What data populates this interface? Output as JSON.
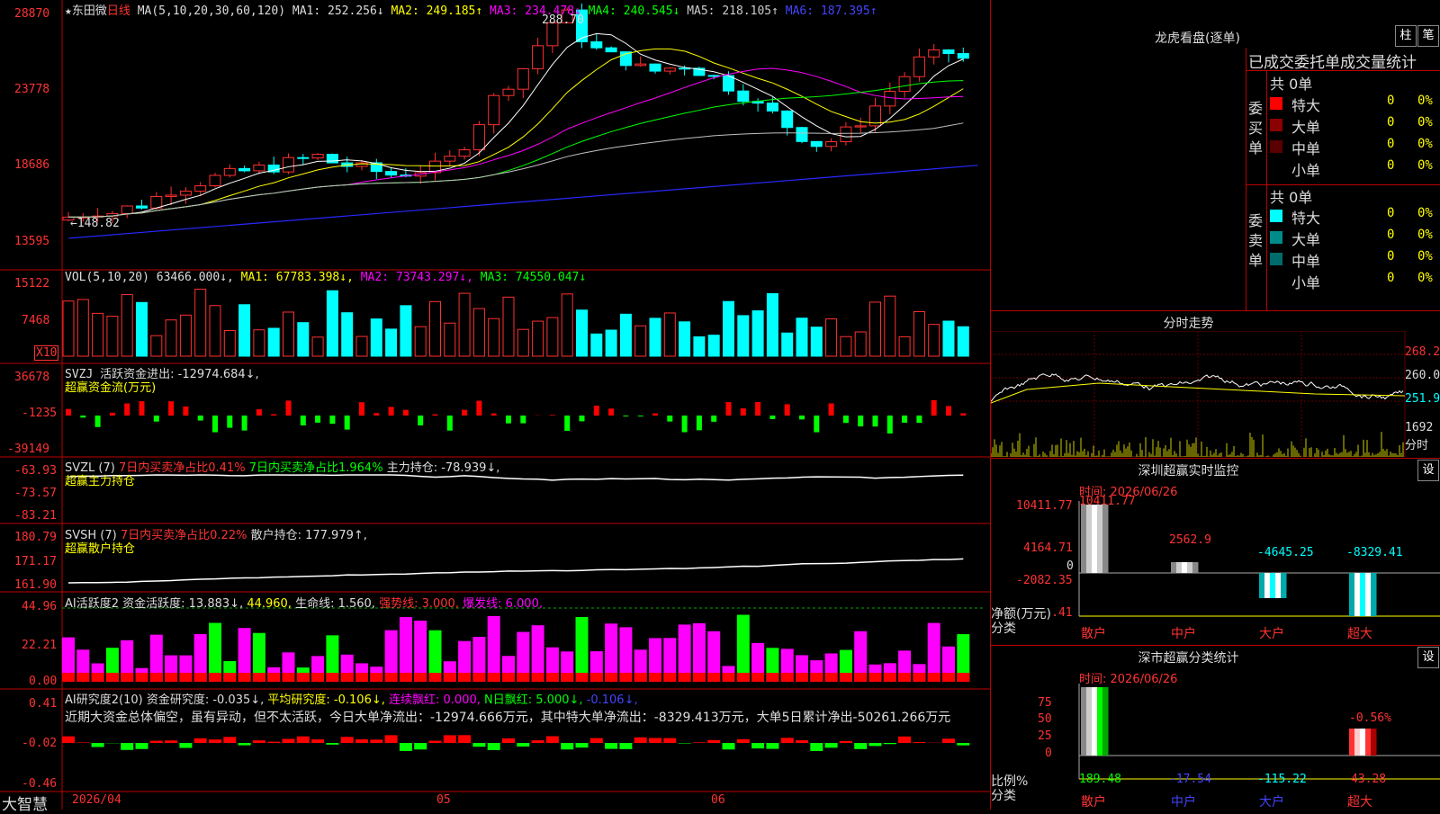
{
  "colors": {
    "up": "#ff3030",
    "down": "#00ffff",
    "ma1": "#ffffff",
    "ma2": "#ffff00",
    "ma3": "#ff00ff",
    "ma4": "#00ff00",
    "ma5": "#c0c0c0",
    "ma6": "#2828ff"
  },
  "price_panel": {
    "header": {
      "star": "★",
      "name": "东田微",
      "period": "日线",
      "ma_label": "MA(5,10,20,30,60,120)",
      "ma1": "MA1: 252.256↓",
      "ma2": "MA2: 249.185↑",
      "ma3": "MA3: 234.478↓",
      "ma4": "MA4: 240.545↓",
      "ma5": "MA5: 218.105↑",
      "ma6": "MA6: 187.395↑"
    },
    "y_ticks": [
      "28870",
      "23778",
      "18686",
      "13595"
    ],
    "high_label": "288.70",
    "low_label": "←148.82"
  },
  "vol_panel": {
    "header": "VOL(5,10,20)",
    "value": "63466.000↓,",
    "ma1": "MA1: 67783.398↓,",
    "ma2": "MA2: 73743.297↓,",
    "ma3": "MA3: 74550.047↓",
    "y_ticks": [
      "15122",
      "7468"
    ],
    "unit": "X10"
  },
  "svzj_panel": {
    "header": "SVZJ",
    "label": "活跃资金进出: -12974.684↓,",
    "sub": "超赢资金流(万元)",
    "y_ticks": [
      "36678",
      "-1235",
      "-39149"
    ]
  },
  "svzl_panel": {
    "header": "SVZL (7)",
    "a": "7日内买卖净占比0.41%",
    "b": "7日内买卖净占比1.964%",
    "c": "主力持仓: -78.939↓,",
    "sub": "超赢主力持仓",
    "y_ticks": [
      "-63.93",
      "-73.57",
      "-83.21"
    ]
  },
  "svsh_panel": {
    "header": "SVSH (7)",
    "a": "7日内买卖净占比0.22%",
    "b": "散户持仓: 177.979↑,",
    "sub": "超赢散户持仓",
    "y_ticks": [
      "180.79",
      "171.17",
      "161.90"
    ]
  },
  "ai1_panel": {
    "header": "AI活跃度2",
    "a": "资金活跃度: 13.883↓,",
    "b": "44.960,",
    "c": "生命线: 1.560,",
    "d": "强势线: 3.000,",
    "e": "爆发线: 6.000,",
    "y_ticks": [
      "44.96",
      "22.21",
      "0.00"
    ]
  },
  "ai2_panel": {
    "header": "AI研究度2(10)",
    "a": "资金研究度: -0.035↓,",
    "b": "平均研究度: -0.106↓,",
    "c": "连续飘红: 0.000,",
    "d": "N日飘红: 5.000↓,",
    "e": "-0.106↓,",
    "text": "近期大资金总体偏空，虽有异动，但不太活跃，今日大单净流出：-12974.666万元，其中特大单净流出：-8329.413万元，大单5日累计净出-50261.266万元",
    "y_ticks": [
      "0.41",
      "-0.02",
      "-0.46"
    ]
  },
  "footer": {
    "brand": "大智慧",
    "dates": [
      "2026/04",
      "05",
      "06"
    ]
  },
  "lhb": {
    "title": "龙虎看盘(逐单)",
    "btn1": "柱",
    "btn2": "笔",
    "tabs": "已成交委托单成交量统计",
    "buy": {
      "side": "委买单",
      "total": "共 0单",
      "rows": [
        {
          "name": "特大",
          "n": "0",
          "p": "0%",
          "color": "#ff0000"
        },
        {
          "name": "大单",
          "n": "0",
          "p": "0%",
          "color": "#8b0000"
        },
        {
          "name": "中单",
          "n": "0",
          "p": "0%",
          "color": "#5a0000"
        },
        {
          "name": "小单",
          "n": "0",
          "p": "0%",
          "color": ""
        }
      ]
    },
    "sell": {
      "side": "委卖单",
      "total": "共 0单",
      "rows": [
        {
          "name": "特大",
          "n": "0",
          "p": "0%",
          "color": "#00ffff"
        },
        {
          "name": "大单",
          "n": "0",
          "p": "0%",
          "color": "#008b8b"
        },
        {
          "name": "中单",
          "n": "0",
          "p": "0%",
          "color": "#006b6b"
        },
        {
          "name": "小单",
          "n": "0",
          "p": "0%",
          "color": ""
        }
      ]
    }
  },
  "fenshi": {
    "title": "分时走势",
    "y": [
      "268.2",
      "260.0",
      "251.9"
    ],
    "vol": "1692",
    "unit": "分时"
  },
  "sz_monitor": {
    "title": "深圳超赢实时监控",
    "set": "设",
    "time": "时间: 2026/06/26",
    "y": [
      "10411.77",
      "4164.71",
      "0",
      "-2082.35",
      "-8329.41"
    ],
    "axis": "净额(万元)",
    "cat_label": "分类",
    "cats": [
      "散户",
      "中户",
      "大户",
      "超大"
    ],
    "values": [
      "10411.77",
      "2562.9",
      "-4645.25",
      "-8329.41"
    ]
  },
  "sz_stats": {
    "title": "深市超赢分类统计",
    "set": "设",
    "time": "时间: 2026/06/26",
    "y": [
      "75",
      "50",
      "25",
      "0"
    ],
    "axis": "比例%",
    "cat_label": "分类",
    "cats": [
      "散户",
      "中户",
      "大户",
      "超大"
    ],
    "values": [
      "189.48",
      "-17.54",
      "-115.22",
      "43.28"
    ],
    "top": "-0.56%"
  }
}
